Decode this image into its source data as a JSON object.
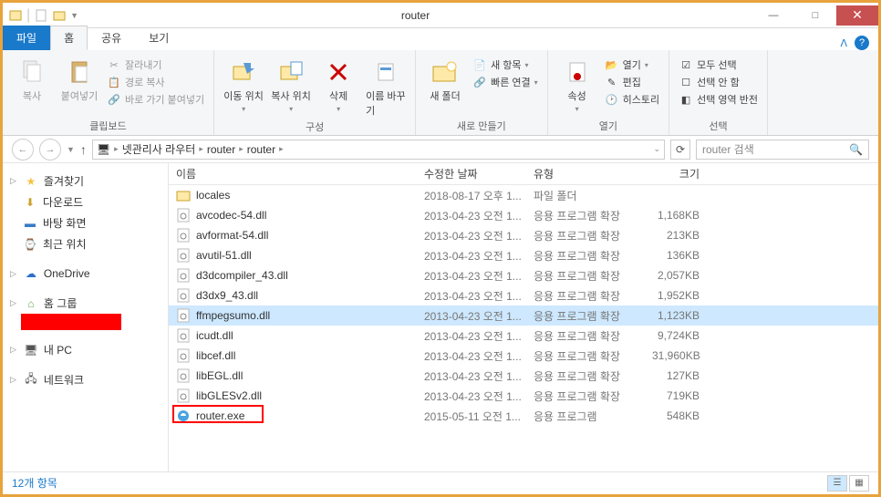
{
  "window": {
    "title": "router"
  },
  "tabs": {
    "file": "파일",
    "home": "홈",
    "share": "공유",
    "view": "보기"
  },
  "ribbon": {
    "clipboard": {
      "label": "클립보드",
      "copy": "복사",
      "paste": "붙여넣기",
      "cut": "잘라내기",
      "copypath": "경로 복사",
      "pasteshortcut": "바로 가기 붙여넣기"
    },
    "organize": {
      "label": "구성",
      "moveto": "이동 위치",
      "copyto": "복사 위치",
      "delete": "삭제",
      "rename": "이름 바꾸기"
    },
    "new": {
      "label": "새로 만들기",
      "newfolder": "새 폴더",
      "newitem": "새 항목",
      "easyaccess": "빠른 연결"
    },
    "open": {
      "label": "열기",
      "properties": "속성",
      "open": "열기",
      "edit": "편집",
      "history": "히스토리"
    },
    "select": {
      "label": "선택",
      "selectall": "모두 선택",
      "selectnone": "선택 안 함",
      "invert": "선택 영역 반전"
    }
  },
  "breadcrumbs": {
    "root": "넷관리사 라우터",
    "p1": "router",
    "p2": "router"
  },
  "search": {
    "placeholder": "router 검색"
  },
  "nav": {
    "favorites": "즐겨찾기",
    "downloads": "다운로드",
    "desktop": "바탕 화면",
    "recent": "최근 위치",
    "onedrive": "OneDrive",
    "homegroup": "홈 그룹",
    "thispc": "내 PC",
    "network": "네트워크"
  },
  "columns": {
    "name": "이름",
    "modified": "수정한 날짜",
    "type": "유형",
    "size": "크기"
  },
  "files": [
    {
      "icon": "folder",
      "name": "locales",
      "date": "2018-08-17 오후 1...",
      "type": "파일 폴더",
      "size": ""
    },
    {
      "icon": "dll",
      "name": "avcodec-54.dll",
      "date": "2013-04-23 오전 1...",
      "type": "응용 프로그램 확장",
      "size": "1,168KB"
    },
    {
      "icon": "dll",
      "name": "avformat-54.dll",
      "date": "2013-04-23 오전 1...",
      "type": "응용 프로그램 확장",
      "size": "213KB"
    },
    {
      "icon": "dll",
      "name": "avutil-51.dll",
      "date": "2013-04-23 오전 1...",
      "type": "응용 프로그램 확장",
      "size": "136KB"
    },
    {
      "icon": "dll",
      "name": "d3dcompiler_43.dll",
      "date": "2013-04-23 오전 1...",
      "type": "응용 프로그램 확장",
      "size": "2,057KB"
    },
    {
      "icon": "dll",
      "name": "d3dx9_43.dll",
      "date": "2013-04-23 오전 1...",
      "type": "응용 프로그램 확장",
      "size": "1,952KB"
    },
    {
      "icon": "dll",
      "name": "ffmpegsumo.dll",
      "date": "2013-04-23 오전 1...",
      "type": "응용 프로그램 확장",
      "size": "1,123KB",
      "selected": true
    },
    {
      "icon": "dll",
      "name": "icudt.dll",
      "date": "2013-04-23 오전 1...",
      "type": "응용 프로그램 확장",
      "size": "9,724KB"
    },
    {
      "icon": "dll",
      "name": "libcef.dll",
      "date": "2013-04-23 오전 1...",
      "type": "응용 프로그램 확장",
      "size": "31,960KB"
    },
    {
      "icon": "dll",
      "name": "libEGL.dll",
      "date": "2013-04-23 오전 1...",
      "type": "응용 프로그램 확장",
      "size": "127KB"
    },
    {
      "icon": "dll",
      "name": "libGLESv2.dll",
      "date": "2013-04-23 오전 1...",
      "type": "응용 프로그램 확장",
      "size": "719KB"
    },
    {
      "icon": "exe",
      "name": "router.exe",
      "date": "2015-05-11 오전 1...",
      "type": "응용 프로그램",
      "size": "548KB",
      "highlight": true
    }
  ],
  "status": {
    "count": "12개 항목"
  }
}
